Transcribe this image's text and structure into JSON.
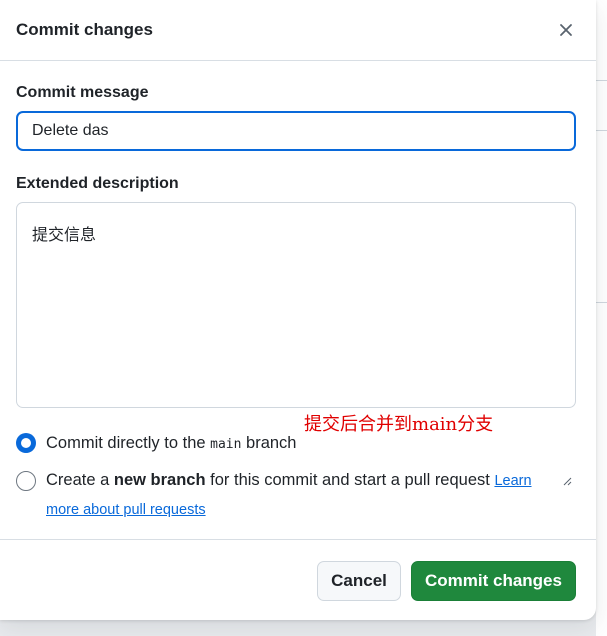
{
  "dialog": {
    "title": "Commit changes",
    "close_icon": "close-icon"
  },
  "form": {
    "message_label": "Commit message",
    "message_value": "Delete das",
    "description_label": "Extended description",
    "description_value": "提交信息"
  },
  "annotation": "提交后合并到main分支",
  "options": {
    "direct_prefix": "Commit directly to the ",
    "direct_branch": "main",
    "direct_suffix": " branch",
    "direct_checked": true,
    "new_prefix": "Create a ",
    "new_bold": "new branch",
    "new_suffix": " for this commit and start a pull request ",
    "new_link": "Learn more about pull requests",
    "new_checked": false
  },
  "footer": {
    "cancel_label": "Cancel",
    "commit_label": "Commit changes"
  },
  "colors": {
    "accent": "#0969da",
    "primary_button": "#1f883d",
    "annotation": "#e00000"
  }
}
